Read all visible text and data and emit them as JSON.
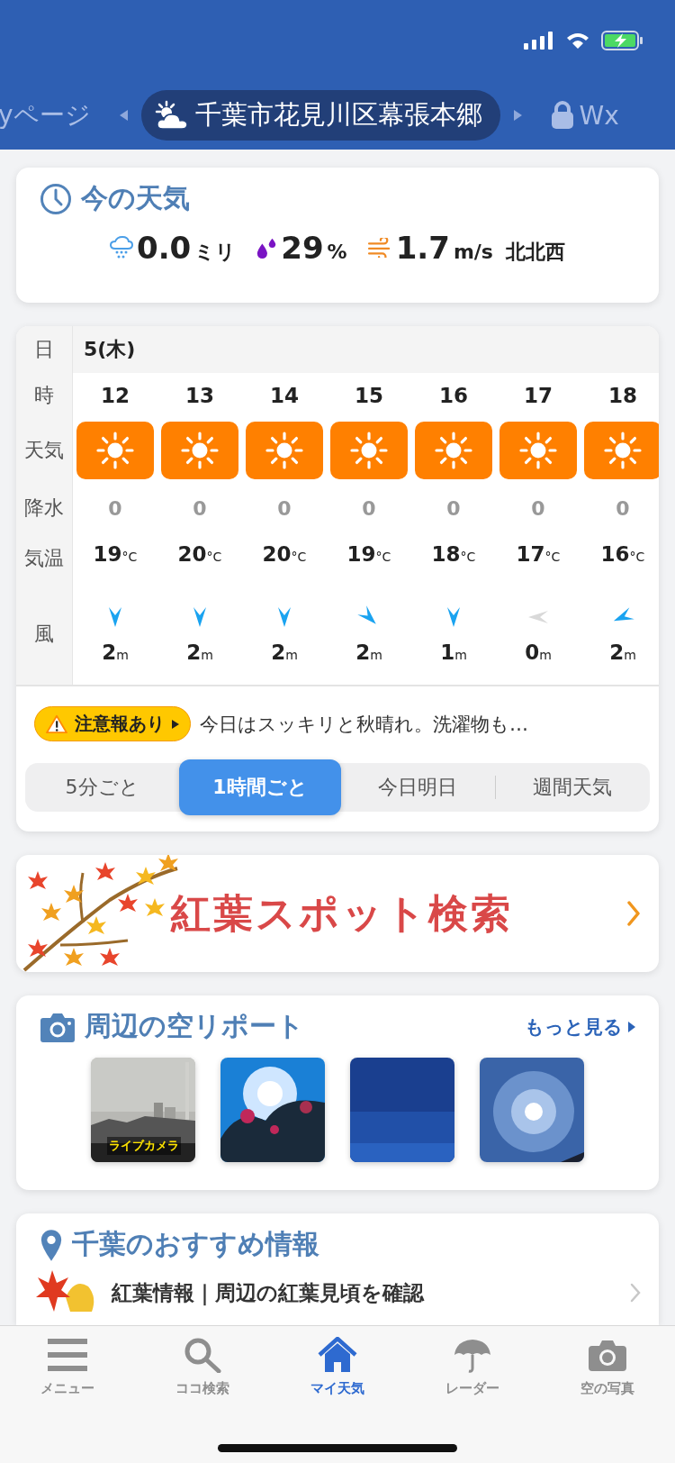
{
  "location_tabs": [
    {
      "label": "yページ",
      "kind": "text",
      "selected": false
    },
    {
      "label": "千葉市花見川区幕張本郷",
      "kind": "location",
      "selected": true
    },
    {
      "label": "Wx",
      "kind": "locked",
      "selected": false
    }
  ],
  "current": {
    "title": "今の天気",
    "precip": {
      "value": "0.0",
      "unit": "ミリ"
    },
    "humidity": {
      "value": "29",
      "unit": "%"
    },
    "wind": {
      "value": "1.7",
      "unit": "m/s",
      "direction": "北北西"
    }
  },
  "forecast": {
    "labels": {
      "date": "日",
      "hour": "時",
      "weather": "天気",
      "precip": "降水",
      "temp": "気温",
      "wind": "風"
    },
    "date": "5(木)",
    "hours": [
      {
        "hour": "12",
        "kind": "sunny",
        "precip": "0",
        "temp": "19",
        "temp_unit": "°C",
        "wind_arrow": {
          "kind": "north"
        },
        "calm": false,
        "wind": "2",
        "wind_unit": "m"
      },
      {
        "hour": "13",
        "kind": "sunny",
        "precip": "0",
        "temp": "20",
        "temp_unit": "°C",
        "wind_arrow": {
          "kind": "north"
        },
        "calm": false,
        "wind": "2",
        "wind_unit": "m"
      },
      {
        "hour": "14",
        "kind": "sunny",
        "precip": "0",
        "temp": "20",
        "temp_unit": "°C",
        "wind_arrow": {
          "kind": "north"
        },
        "calm": false,
        "wind": "2",
        "wind_unit": "m"
      },
      {
        "hour": "15",
        "kind": "sunny",
        "precip": "0",
        "temp": "19",
        "temp_unit": "°C",
        "wind_arrow": {
          "kind": "northwest"
        },
        "calm": false,
        "wind": "2",
        "wind_unit": "m"
      },
      {
        "hour": "16",
        "kind": "sunny",
        "precip": "0",
        "temp": "18",
        "temp_unit": "°C",
        "wind_arrow": {
          "kind": "north"
        },
        "calm": false,
        "wind": "1",
        "wind_unit": "m"
      },
      {
        "hour": "17",
        "kind": "sunny",
        "precip": "0",
        "temp": "17",
        "temp_unit": "°C",
        "wind_arrow": {
          "kind": "east"
        },
        "calm": true,
        "wind": "0",
        "wind_unit": "m"
      },
      {
        "hour": "18",
        "kind": "sunny",
        "precip": "0",
        "temp": "16",
        "temp_unit": "°C",
        "wind_arrow": {
          "kind": "eastnortheast"
        },
        "calm": false,
        "wind": "2",
        "wind_unit": "m"
      }
    ],
    "alert": {
      "label": "注意報あり",
      "text": "今日はスッキリと秋晴れ。洗濯物も…"
    },
    "modes": [
      {
        "label": "5分ごと",
        "selected": false
      },
      {
        "label": "1時間ごと",
        "selected": true
      },
      {
        "label": "今日明日",
        "selected": false
      },
      {
        "label": "週間天気",
        "selected": false
      }
    ]
  },
  "banner": {
    "title": "紅葉スポット検索"
  },
  "sky_report": {
    "title": "周辺の空リポート",
    "more": "もっと見る",
    "photos": [
      {
        "kind": "city",
        "label": "ライブカメラ"
      },
      {
        "kind": "flowers"
      },
      {
        "kind": "sky"
      },
      {
        "kind": "sun"
      }
    ]
  },
  "recommend": {
    "title": "千葉のおすすめ情報",
    "items": [
      {
        "text": "紅葉情報｜周辺の紅葉見頃を確認"
      }
    ]
  },
  "tab_bar": [
    {
      "kind": "menu",
      "label": "メニュー",
      "selected": false
    },
    {
      "kind": "search",
      "label": "ココ検索",
      "selected": false
    },
    {
      "kind": "home",
      "label": "マイ天気",
      "selected": true
    },
    {
      "kind": "radar",
      "label": "レーダー",
      "selected": false
    },
    {
      "kind": "camera",
      "label": "空の写真",
      "selected": false
    }
  ]
}
